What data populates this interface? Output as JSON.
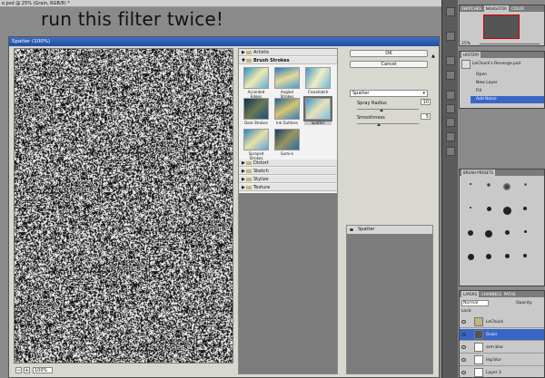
{
  "doc_tab": {
    "title": "e.psd @ 25% (Grain, RGB/8) *"
  },
  "annotation": "run this filter twice!",
  "dialog": {
    "title": "Spatter (100%)",
    "zoom": {
      "minus": "−",
      "plus": "+",
      "value": "100%"
    },
    "gallery": {
      "categories_top": [
        {
          "label": "Artistic",
          "open": false
        },
        {
          "label": "Brush Strokes",
          "open": true
        }
      ],
      "thumbs": [
        {
          "label": "Accented Edges"
        },
        {
          "label": "Angled Strokes"
        },
        {
          "label": "Crosshatch"
        },
        {
          "label": "Dark Strokes"
        },
        {
          "label": "Ink Outlines"
        },
        {
          "label": "Spatter"
        },
        {
          "label": "Sprayed Strokes"
        },
        {
          "label": "Sumi-e"
        }
      ],
      "categories_bottom": [
        {
          "label": "Distort"
        },
        {
          "label": "Sketch"
        },
        {
          "label": "Stylize"
        },
        {
          "label": "Texture"
        }
      ]
    },
    "ok_label": "OK",
    "cancel_label": "Cancel",
    "filter_select": "Spatter",
    "params": [
      {
        "label": "Spray Radius",
        "value": "10",
        "level": 0.4
      },
      {
        "label": "Smoothness",
        "value": "5",
        "level": 0.35
      }
    ],
    "layer": {
      "name": "Spatter"
    }
  },
  "ps": {
    "navigator_tabs": [
      "SWATCHES",
      "NAVIGATOR",
      "COLOR"
    ],
    "navigator_zoom": "25%",
    "history": {
      "title": "HISTORY",
      "doc": "LeChuck's Revenge.psd",
      "items": [
        "Open",
        "New Layer",
        "Fill",
        "Add Noise"
      ]
    },
    "brush_presets_title": "BRUSH PRESETS",
    "brush_sizes": [
      "",
      "",
      "",
      "",
      "",
      "",
      "",
      "",
      "",
      "",
      "",
      "",
      "",
      "",
      "",
      ""
    ],
    "layers_tabs": [
      "LAYERS",
      "CHANNELS",
      "PATHS"
    ],
    "blend_mode": "Normal",
    "opacity": "Opacity:",
    "lock": "Lock:",
    "layers": [
      {
        "name": "LeChuck",
        "active": false
      },
      {
        "name": "Grain",
        "active": true
      },
      {
        "name": "arm blur",
        "active": false
      },
      {
        "name": "leg blur",
        "active": false
      },
      {
        "name": "Layer 2",
        "active": false
      }
    ]
  },
  "colors": {
    "accent": "#3a66c6"
  }
}
